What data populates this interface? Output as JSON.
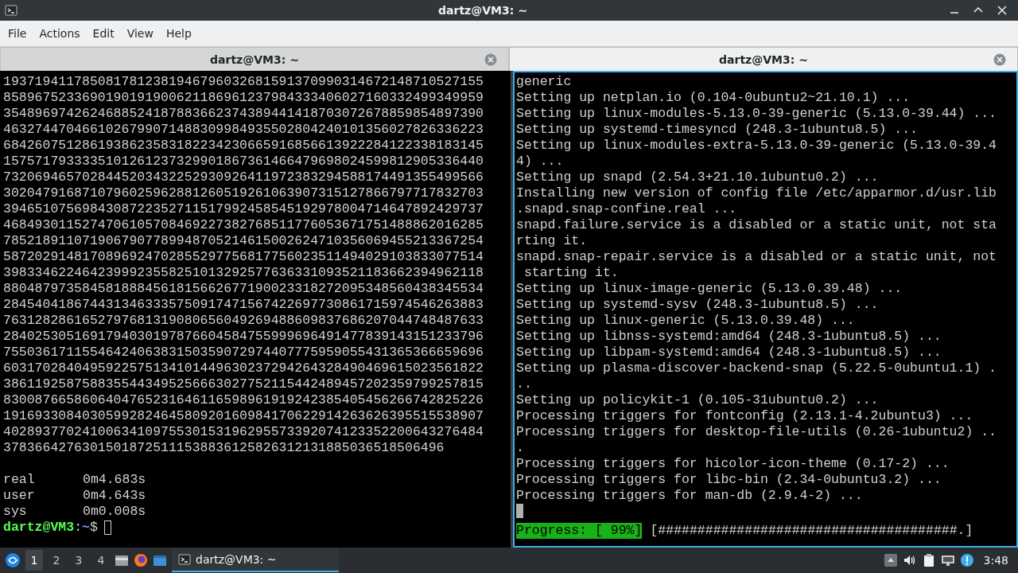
{
  "window": {
    "title": "dartz@VM3: ~"
  },
  "menu": [
    "File",
    "Actions",
    "Edit",
    "View",
    "Help"
  ],
  "tabs": [
    {
      "label": "dartz@VM3: ~",
      "selected": false
    },
    {
      "label": "dartz@VM3: ~",
      "selected": true
    }
  ],
  "panes": [
    {
      "active": false,
      "lines": [
        "1937194117850817812381946796032681591370990314672148710527155",
        "8589675233690190191900621186961237984333406027160332499349959",
        "3548969742624688524187883662374389441418703072678859854897390",
        "4632744704661026799071488309984935502804240101356027826336223",
        "6842607512861938623583182234230665916856613922284122338183145",
        "1575717933335101261237329901867361466479698024599812905336440",
        "7320694657028445203432252930926411972383294588174491355499566",
        "3020479168710796025962881260519261063907315127866797717832703",
        "3946510756984308722352711517992458545192978004714647892429737",
        "4684930115274706105708469227382768511776053671751488862016285",
        "7852189110719067907789948705214615002624710356069455213367254",
        "5872029148170896924702855297756817756023511494029103833077514",
        "3983346224642399923558251013292577636331093521183662394962118",
        "8804879735845818884561815662677190023318272095348560438345534",
        "2845404186744313463335750917471567422697730861715974546263883",
        "7631282861652797681319080656049269488609837686207044748487633",
        "2840253051691794030197876604584755999696491477839143151233796",
        "7550361711554642406383150359072974407775959055431365366659696",
        "6031702840495922575134101449630237294264328490469615023561822",
        "3861192587588355443495256663027752115442489457202359799257815",
        "8300876658606404765231646116598961919242385405456266742825226",
        "1916933084030599282464580920160984170622914263626395515538907",
        "4028937702410063410975530153196295573392074123352200643276484",
        "37836642763015018725111538836125826312131885036518506496"
      ],
      "timing": [
        {
          "label": "real",
          "value": "0m4.683s"
        },
        {
          "label": "user",
          "value": "0m4.643s"
        },
        {
          "label": "sys",
          "value": "0m0.008s"
        }
      ],
      "prompt": {
        "user_host": "dartz@VM3",
        "separator": ":",
        "path": "~",
        "symbol": "$"
      }
    },
    {
      "active": true,
      "lines": [
        "generic",
        "Setting up netplan.io (0.104-0ubuntu2~21.10.1) ...",
        "Setting up linux-modules-5.13.0-39-generic (5.13.0-39.44) ...",
        "Setting up systemd-timesyncd (248.3-1ubuntu8.5) ...",
        "Setting up linux-modules-extra-5.13.0-39-generic (5.13.0-39.4",
        "4) ...",
        "Setting up snapd (2.54.3+21.10.1ubuntu0.2) ...",
        "Installing new version of config file /etc/apparmor.d/usr.lib",
        ".snapd.snap-confine.real ...",
        "snapd.failure.service is a disabled or a static unit, not sta",
        "rting it.",
        "snapd.snap-repair.service is a disabled or a static unit, not",
        " starting it.",
        "Setting up linux-image-generic (5.13.0.39.48) ...",
        "Setting up systemd-sysv (248.3-1ubuntu8.5) ...",
        "Setting up linux-generic (5.13.0.39.48) ...",
        "Setting up libnss-systemd:amd64 (248.3-1ubuntu8.5) ...",
        "Setting up libpam-systemd:amd64 (248.3-1ubuntu8.5) ...",
        "Setting up plasma-discover-backend-snap (5.22.5-0ubuntu1.1) .",
        "..",
        "Setting up policykit-1 (0.105-31ubuntu0.2) ...",
        "Processing triggers for fontconfig (2.13.1-4.2ubuntu3) ...",
        "Processing triggers for desktop-file-utils (0.26-1ubuntu2) ..",
        ".",
        "Processing triggers for hicolor-icon-theme (0.17-2) ...",
        "Processing triggers for libc-bin (2.34-0ubuntu3.2) ...",
        "Processing triggers for man-db (2.9.4-2) ..."
      ],
      "progress": {
        "label": "Progress: [ 99%]",
        "bar": "[######################################.]"
      }
    }
  ],
  "taskbar": {
    "workspaces": [
      {
        "label": "1",
        "selected": true
      },
      {
        "label": "2",
        "selected": false
      },
      {
        "label": "3",
        "selected": false
      },
      {
        "label": "4",
        "selected": false
      }
    ],
    "tasks": [
      {
        "label": "dartz@VM3: ~",
        "selected": true
      }
    ],
    "clock": "3:48"
  }
}
